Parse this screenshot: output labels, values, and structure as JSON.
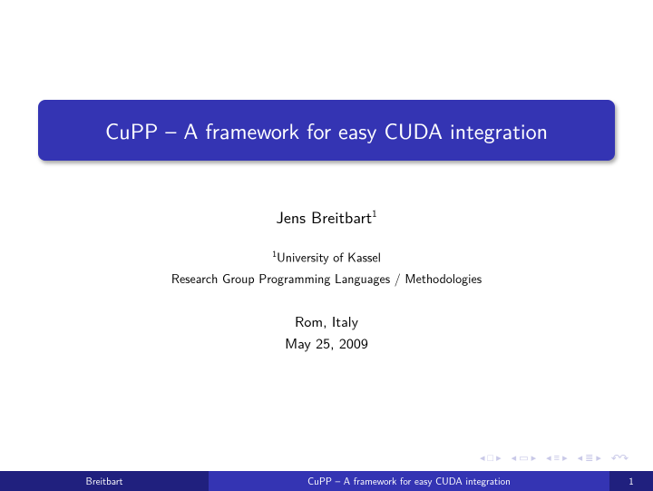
{
  "title": "CuPP – A framework for easy CUDA integration",
  "author": {
    "name": "Jens Breitbart",
    "mark": "1"
  },
  "affiliation": {
    "mark": "1",
    "institution": "University of Kassel",
    "group": "Research Group Programming Languages / Methodologies"
  },
  "location": "Rom, Italy",
  "date": "May 25, 2009",
  "footer": {
    "author": "Breitbart",
    "title": "CuPP – A framework for easy CUDA integration",
    "page": "1"
  }
}
